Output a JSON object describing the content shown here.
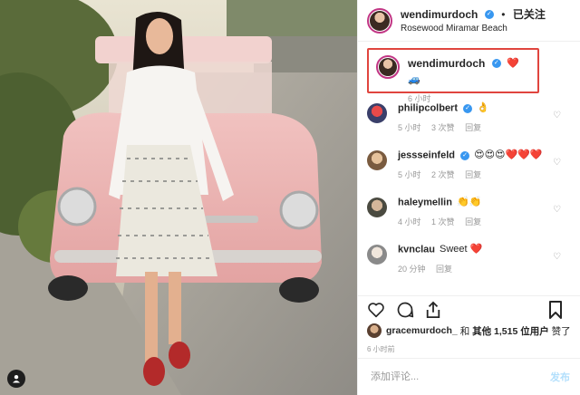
{
  "photo": {
    "alt_description_icon": "user-tag-icon"
  },
  "header": {
    "username": "wendimurdoch",
    "separator": "•",
    "follow_label": "已关注",
    "location": "Rosewood Miramar Beach"
  },
  "caption": {
    "username": "wendimurdoch",
    "emoji": "❤️🚙",
    "time": "6 小时"
  },
  "comments": [
    {
      "username": "philipcolbert",
      "text": "👌",
      "time": "5 小时",
      "likes": "3 次赞",
      "reply": "回复"
    },
    {
      "username": "jessseinfeld",
      "text": "😍😍😍❤️❤️❤️",
      "time": "5 小时",
      "likes": "2 次赞",
      "reply": "回复"
    },
    {
      "username": "haleymellin",
      "text": "👏👏",
      "time": "4 小时",
      "likes": "1 次赞",
      "reply": "回复"
    },
    {
      "username": "kvnclau",
      "text": "Sweet ❤️",
      "time": "20 分钟",
      "likes": "",
      "reply": "回复"
    }
  ],
  "likes_line": {
    "first_user": "gracemurdoch_",
    "and": " 和 ",
    "others": "其他 1,515 位用户",
    "suffix": " 赞了"
  },
  "post_time": "6 小时前",
  "add_comment": {
    "placeholder": "添加评论...",
    "send_label": "发布"
  },
  "colors": {
    "verified": "#3897f0",
    "highlight_border": "#e0453e",
    "heart": "#ed4956"
  }
}
